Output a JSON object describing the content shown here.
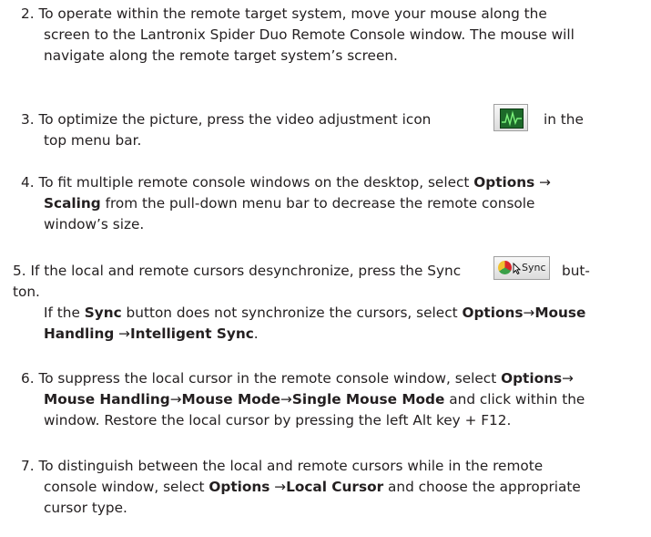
{
  "steps": [
    {
      "lines": [
        [
          "2.  To operate within the remote target system, move your mouse along the"
        ],
        [
          "screen to the Lantronix Spider Duo Remote Console window. The mouse will"
        ],
        [
          "navigate along the remote target system’s screen."
        ]
      ]
    },
    {
      "lines": [
        [
          "3.  To optimize the picture, press the video adjustment icon",
          "in the"
        ],
        [
          "top menu bar."
        ]
      ],
      "icon": "video-adjustment-icon"
    },
    {
      "lines": [
        [
          "4.  To fit multiple remote console windows on the desktop, select ",
          "Options",
          " →"
        ],
        [
          "Scaling",
          " from the pull-down menu bar to decrease the remote console"
        ],
        [
          "window’s size."
        ]
      ]
    },
    {
      "lines": [
        [
          "5.  If the local and remote cursors desynchronize, press the Sync",
          "but-"
        ],
        [
          "ton."
        ],
        [
          "If the ",
          "Sync",
          " button does not synchronize the cursors, select ",
          "Options",
          "→",
          "Mouse"
        ],
        [
          "Handling",
          " →",
          "Intelligent Sync",
          "."
        ]
      ],
      "icon": "sync-icon",
      "sync_label": "Sync"
    },
    {
      "lines": [
        [
          "6.  To suppress the local cursor in the remote console window, select ",
          "Options",
          "→"
        ],
        [
          "Mouse Handling",
          "→",
          "Mouse Mode",
          "→",
          "Single Mouse Mode",
          " and click within the"
        ],
        [
          "window. Restore the local cursor by pressing the left  Alt key + F12."
        ]
      ]
    },
    {
      "lines": [
        [
          "7.  To distinguish between the local and remote cursors while in the remote"
        ],
        [
          "console window, select ",
          "Options",
          " →",
          "Local Cursor",
          " and choose the appropriate"
        ],
        [
          "cursor type."
        ]
      ]
    }
  ]
}
